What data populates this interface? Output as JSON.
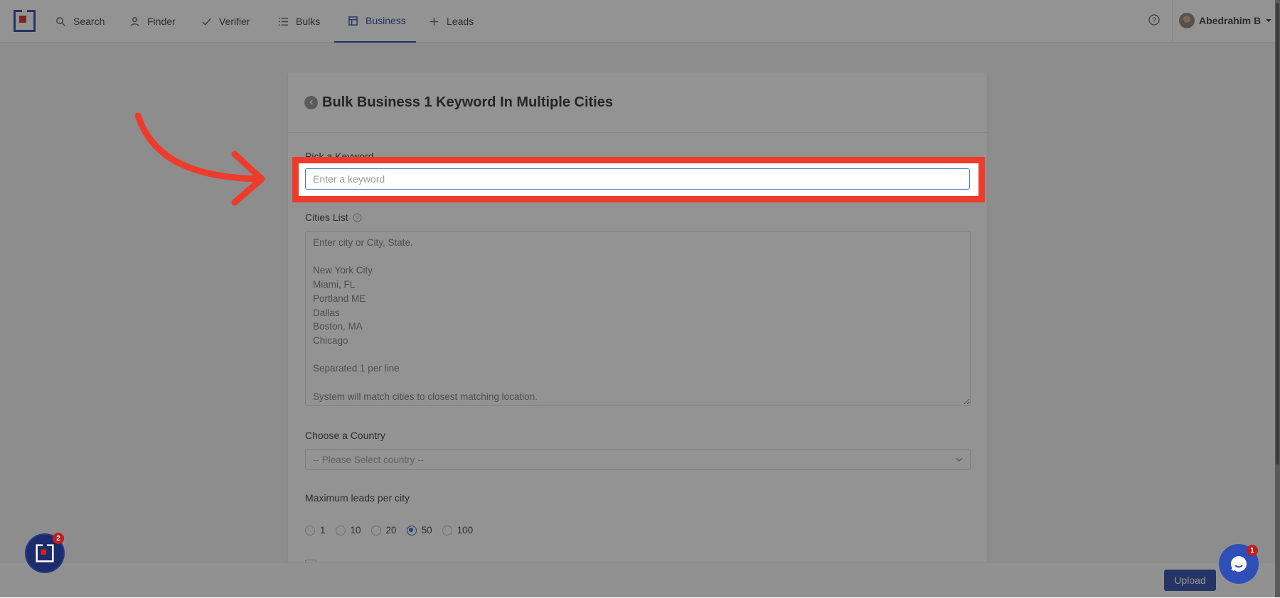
{
  "nav": {
    "items": [
      {
        "label": "Search",
        "icon": "search-icon"
      },
      {
        "label": "Finder",
        "icon": "person-icon"
      },
      {
        "label": "Verifier",
        "icon": "check-icon"
      },
      {
        "label": "Bulks",
        "icon": "list-icon"
      },
      {
        "label": "Business",
        "icon": "business-icon",
        "active": true
      },
      {
        "label": "Leads",
        "icon": "plus-icon"
      }
    ],
    "user_name": "Abedrahim B",
    "accent_color": "#1f3d9c"
  },
  "page": {
    "title": "Bulk Business 1 Keyword In Multiple Cities",
    "keyword_label": "Pick a Keyword",
    "keyword_placeholder": "Enter a keyword",
    "keyword_value": "",
    "cities_label": "Cities List",
    "cities_placeholder": "Enter city or City, State.\n\nNew York City\nMiami, FL\nPortland ME\nDallas\nBoston, MA\nChicago\n\nSeparated 1 per line\n\nSystem will match cities to closest matching location.",
    "country_label": "Choose a Country",
    "country_selected": "-- Please Select country --",
    "max_leads_label": "Maximum leads per city",
    "max_leads_options": [
      "1",
      "10",
      "20",
      "50",
      "100"
    ],
    "max_leads_selected": "50",
    "upload_label": "Upload"
  },
  "widgets": {
    "left_badge": "2",
    "chat_badge": "1"
  }
}
